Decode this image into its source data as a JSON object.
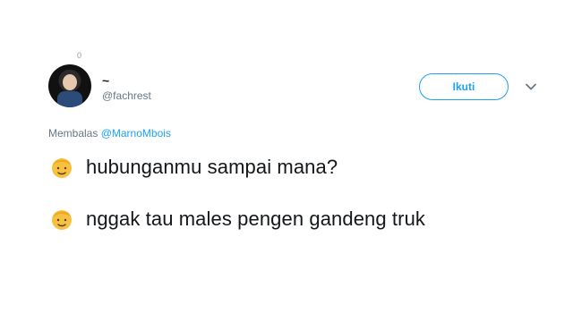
{
  "top_marker": "0",
  "user": {
    "display_name": "~",
    "handle": "@fachrest"
  },
  "actions": {
    "follow_label": "Ikuti",
    "chevron_icon": "chevron-down-icon"
  },
  "reply": {
    "prefix": "Membalas",
    "mention": "@MarnoMbois"
  },
  "messages": [
    {
      "emoji": "boy-emoji",
      "text": "hubunganmu sampai mana?"
    },
    {
      "emoji": "boy-emoji",
      "text": "nggak tau males pengen gandeng truk"
    }
  ],
  "colors": {
    "accent": "#1da1f2",
    "secondary_text": "#657786",
    "primary_text": "#14171a"
  }
}
